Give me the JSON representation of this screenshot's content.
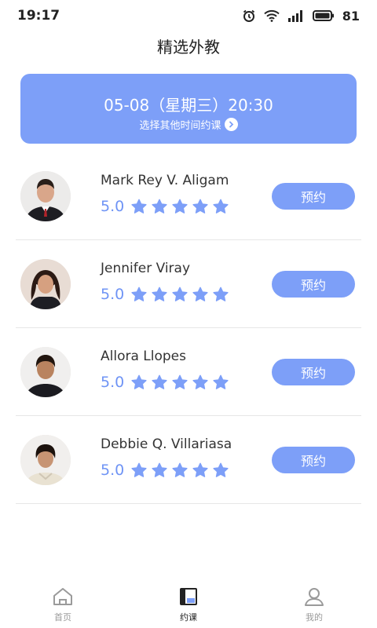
{
  "status_bar": {
    "time": "19:17",
    "battery": "81",
    "icons": [
      "alarm-icon",
      "wifi-icon",
      "signal-icon",
      "battery-icon"
    ]
  },
  "page": {
    "title": "精选外教"
  },
  "banner": {
    "datetime": "05-08（星期三）20:30",
    "subtitle": "选择其他时间约课"
  },
  "teachers": [
    {
      "name": "Mark Rey V. Aligam",
      "rating": "5.0",
      "stars": 5,
      "button": "预约"
    },
    {
      "name": "Jennifer Viray",
      "rating": "5.0",
      "stars": 5,
      "button": "预约"
    },
    {
      "name": "Allora Llopes",
      "rating": "5.0",
      "stars": 5,
      "button": "预约"
    },
    {
      "name": "Debbie Q. Villariasa",
      "rating": "5.0",
      "stars": 5,
      "button": "预约"
    }
  ],
  "tabbar": {
    "items": [
      {
        "label": "首页",
        "icon": "home-icon",
        "active": false
      },
      {
        "label": "约课",
        "icon": "book-class-icon",
        "active": true
      },
      {
        "label": "我的",
        "icon": "profile-icon",
        "active": false
      }
    ]
  },
  "colors": {
    "accent": "#7d9ff8",
    "rating_text": "#6f94f5",
    "divider": "#e6e6e6"
  }
}
